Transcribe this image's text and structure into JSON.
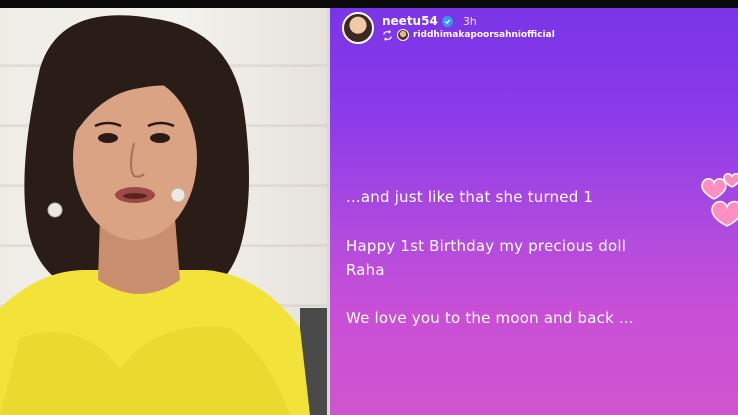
{
  "story": {
    "username": "neetu54",
    "time": "3h",
    "reposted_from": "riddhimakapoorsahniofficial",
    "lines": [
      "...and just like that she turned 1",
      "Happy 1st Birthday my precious doll",
      "Raha",
      "We love you to the moon and back ..."
    ],
    "gradient_top": "#7a35e6",
    "gradient_bottom": "#cf55cf"
  },
  "icons": {
    "verified": "verified-badge-icon",
    "repost": "repost-icon",
    "hearts": "hearts-sticker-icon"
  }
}
